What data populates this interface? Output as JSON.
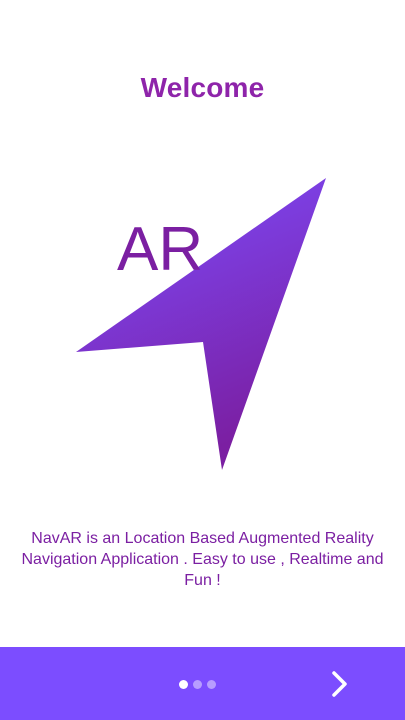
{
  "welcome": {
    "title": "Welcome",
    "logo_text": "AR",
    "description": "NavAR is an Location Based Augmented Reality Navigation Application . Easy to use , Realtime and Fun !"
  },
  "pager": {
    "total_pages": 3,
    "current_page": 1
  },
  "navigation": {
    "next_icon": "chevron-right-icon"
  },
  "colors": {
    "title": "#8e24aa",
    "logo_light": "#7c4dff",
    "logo_dark": "#7b1fa2",
    "bottom_bar": "#7c4dff"
  }
}
